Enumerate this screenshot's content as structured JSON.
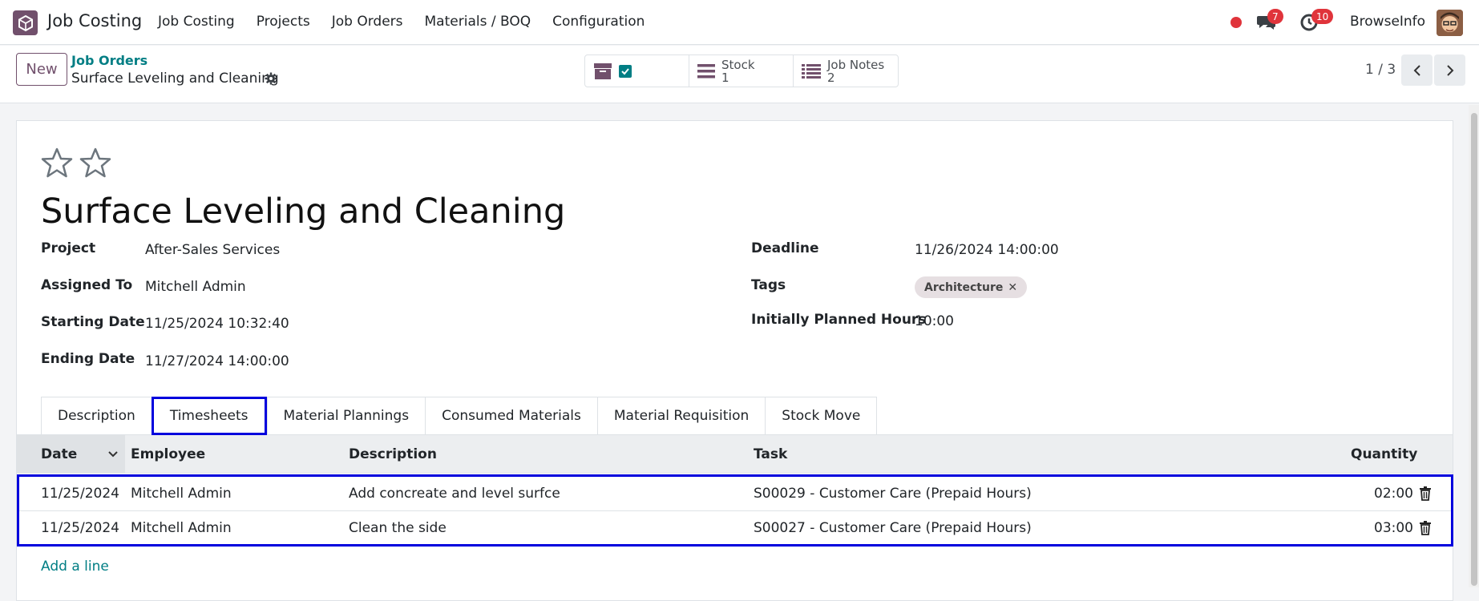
{
  "navbar": {
    "app_name": "Job Costing",
    "menu": [
      "Job Costing",
      "Projects",
      "Job Orders",
      "Materials / BOQ",
      "Configuration"
    ],
    "messages_count": "7",
    "activities_count": "10",
    "company": "BrowseInfo"
  },
  "control": {
    "new_label": "New",
    "breadcrumb_parent": "Job Orders",
    "breadcrumb_current": "Surface Leveling and Cleaning",
    "smart_buttons": [
      {
        "label": "",
        "value": ""
      },
      {
        "label": "Stock",
        "value": "1"
      },
      {
        "label": "Job Notes",
        "value": "2"
      }
    ],
    "pager": "1 / 3"
  },
  "form": {
    "title": "Surface Leveling and Cleaning",
    "project_label": "Project",
    "project_value": "After-Sales Services",
    "assigned_label": "Assigned To",
    "assigned_value": "Mitchell Admin",
    "start_label": "Starting Date",
    "start_value": "11/25/2024 10:32:40",
    "end_label": "Ending Date",
    "end_value": "11/27/2024 14:00:00",
    "deadline_label": "Deadline",
    "deadline_value": "11/26/2024 14:00:00",
    "tags_label": "Tags",
    "tag": "Architecture",
    "hours_label": "Initially Planned Hours",
    "hours_value": "10:00"
  },
  "tabs": [
    "Description",
    "Timesheets",
    "Material Plannings",
    "Consumed Materials",
    "Material Requisition",
    "Stock Move"
  ],
  "table": {
    "headers": {
      "date": "Date",
      "employee": "Employee",
      "description": "Description",
      "task": "Task",
      "quantity": "Quantity"
    },
    "rows": [
      {
        "date": "11/25/2024",
        "employee": "Mitchell Admin",
        "description": "Add concreate and level surfce",
        "task": "S00029 - Customer Care (Prepaid Hours)",
        "quantity": "02:00"
      },
      {
        "date": "11/25/2024",
        "employee": "Mitchell Admin",
        "description": "Clean the side",
        "task": "S00027 - Customer Care (Prepaid Hours)",
        "quantity": "03:00"
      }
    ],
    "add_line": "Add a line"
  },
  "colors": {
    "brand": "#71506c",
    "link": "#017e84",
    "highlight": "#0000dd",
    "badge": "#e0343b"
  }
}
